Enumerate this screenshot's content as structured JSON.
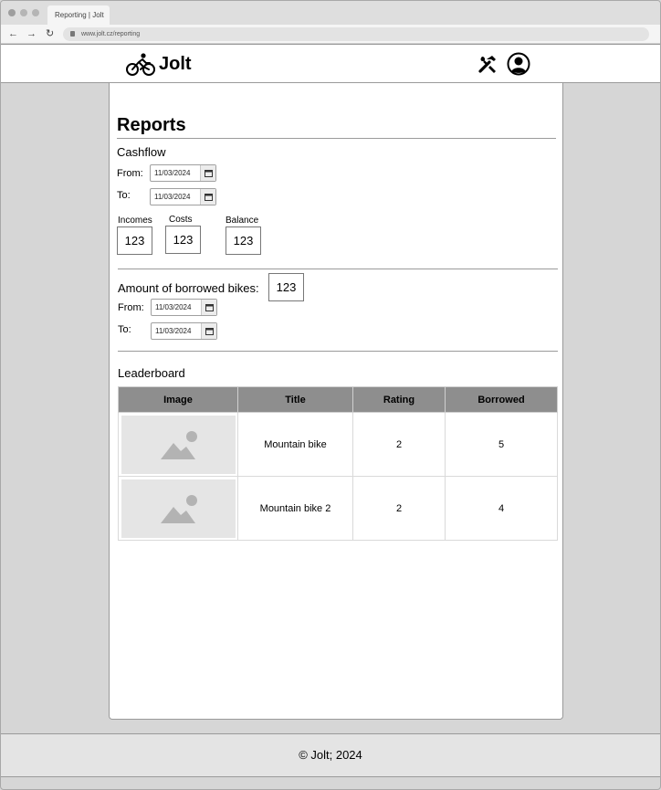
{
  "browser": {
    "tab_title": "Reporting | Jolt",
    "url": "www.jolt.cz/reporting"
  },
  "header": {
    "brand": "Jolt",
    "icons": [
      "bicycle-icon",
      "tools-icon",
      "user-avatar-icon"
    ]
  },
  "page": {
    "title": "Reports"
  },
  "cashflow": {
    "section_title": "Cashflow",
    "from_label": "From:",
    "from_value": "11/03/2024",
    "to_label": "To:",
    "to_value": "11/03/2024",
    "incomes_label": "Incomes",
    "incomes_value": "123",
    "costs_label": "Costs",
    "costs_value": "123",
    "balance_label": "Balance",
    "balance_value": "123"
  },
  "borrowed": {
    "section_title": "Amount of borrowed bikes:",
    "value": "123",
    "from_label": "From:",
    "from_value": "11/03/2024",
    "to_label": "To:",
    "to_value": "11/03/2024"
  },
  "leaderboard": {
    "section_title": "Leaderboard",
    "columns": [
      "Image",
      "Title",
      "Rating",
      "Borrowed"
    ],
    "rows": [
      {
        "title": "Mountain bike",
        "rating": "2",
        "borrowed": "5"
      },
      {
        "title": "Mountain bike 2",
        "rating": "2",
        "borrowed": "4"
      }
    ]
  },
  "footer": {
    "text": "© Jolt; 2024"
  }
}
